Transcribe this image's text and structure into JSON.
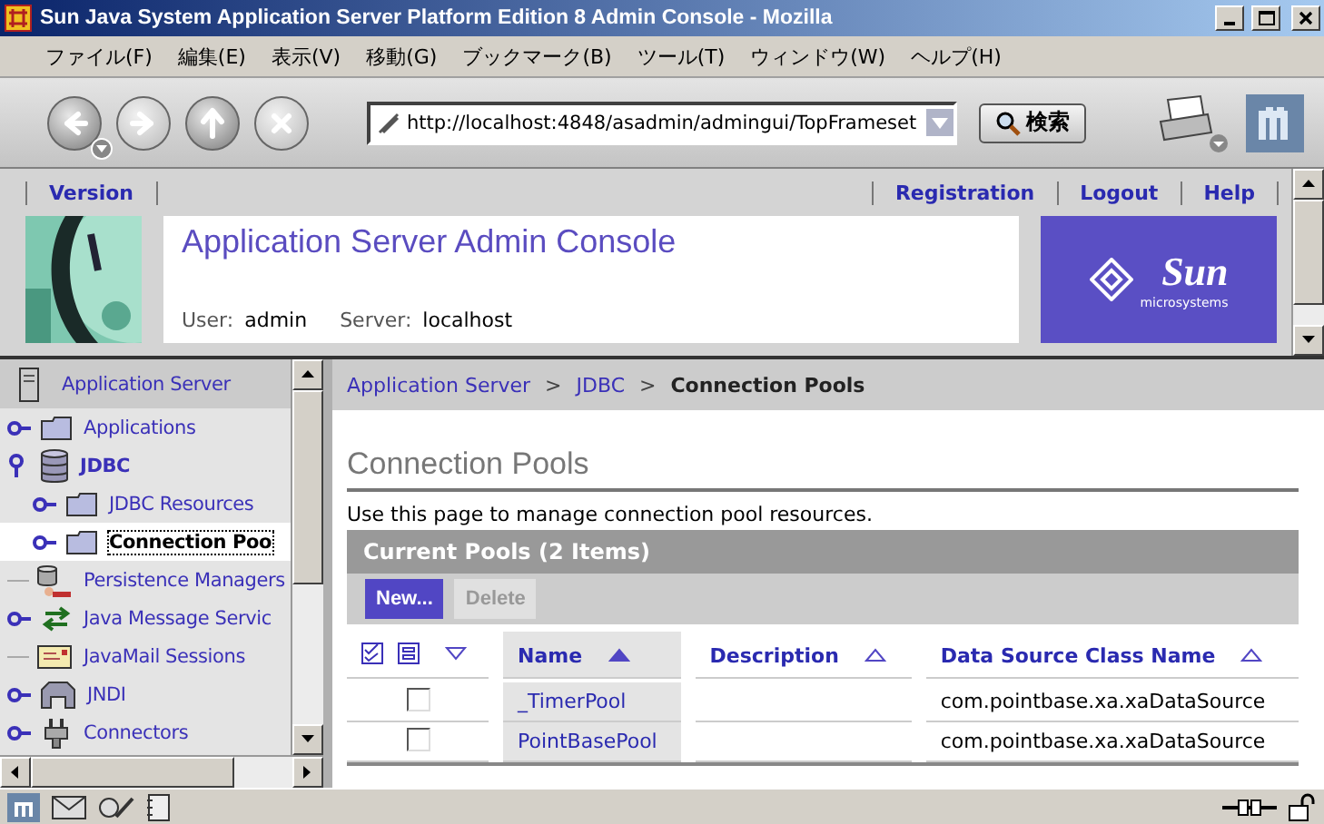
{
  "window": {
    "title": "Sun Java System Application Server Platform Edition 8 Admin Console - Mozilla"
  },
  "menu": [
    "ファイル(F)",
    "編集(E)",
    "表示(V)",
    "移動(G)",
    "ブックマーク(B)",
    "ツール(T)",
    "ウィンドウ(W)",
    "ヘルプ(H)"
  ],
  "toolbar": {
    "buttons": [
      {
        "kind": "back",
        "disabled": false,
        "dropdown": true
      },
      {
        "kind": "forward",
        "disabled": true,
        "dropdown": false
      },
      {
        "kind": "reload",
        "disabled": false,
        "dropdown": false
      },
      {
        "kind": "stop",
        "disabled": true,
        "dropdown": false
      }
    ],
    "url": "http://localhost:4848/asadmin/admingui/TopFrameset",
    "search": "検索"
  },
  "header": {
    "left_links": [
      "Version"
    ],
    "right_links": [
      "Registration",
      "Logout",
      "Help"
    ],
    "title": "Application Server Admin Console",
    "user_label": "User:",
    "user": "admin",
    "server_label": "Server:",
    "server": "localhost",
    "logo": {
      "name": "Sun",
      "tagline": "microsystems"
    }
  },
  "tree": {
    "root": {
      "label": "Application Server"
    },
    "items": [
      {
        "label": "Applications",
        "kind": "folder",
        "expandable": true,
        "expanded": false,
        "selected": false
      },
      {
        "label": "JDBC",
        "kind": "database",
        "expandable": true,
        "expanded": true,
        "selected": false,
        "children": [
          {
            "label": "JDBC Resources",
            "kind": "folder",
            "expandable": true,
            "expanded": false,
            "selected": false
          },
          {
            "label": "Connection Poo",
            "kind": "folder",
            "expandable": true,
            "expanded": false,
            "selected": true
          }
        ]
      },
      {
        "label": "Persistence Managers",
        "kind": "persistence",
        "expandable": false,
        "expanded": false,
        "selected": false
      },
      {
        "label": "Java Message Servic",
        "kind": "messaging",
        "expandable": true,
        "expanded": false,
        "selected": false
      },
      {
        "label": "JavaMail Sessions",
        "kind": "mail",
        "expandable": false,
        "expanded": false,
        "selected": false
      },
      {
        "label": "JNDI",
        "kind": "directory",
        "expandable": true,
        "expanded": false,
        "selected": false
      },
      {
        "label": "Connectors",
        "kind": "connector",
        "expandable": true,
        "expanded": false,
        "selected": false
      }
    ]
  },
  "breadcrumb": {
    "separator": ">",
    "items": [
      {
        "label": "Application Server",
        "current": false
      },
      {
        "label": "JDBC",
        "current": false
      },
      {
        "label": "Connection Pools",
        "current": true
      }
    ]
  },
  "page": {
    "title": "Connection Pools",
    "description": "Use this page to manage connection pool resources.",
    "table": {
      "title": "Current Pools (2 Items)",
      "buttons": [
        {
          "label": "New...",
          "disabled": false
        },
        {
          "label": "Delete",
          "disabled": true
        }
      ],
      "columns": [
        {
          "label": "Name",
          "sorted": true
        },
        {
          "label": "Description",
          "sorted": false
        },
        {
          "label": "Data Source Class Name",
          "sorted": false
        }
      ],
      "rows": [
        {
          "checked": false,
          "name": "_TimerPool",
          "class_name": "com.pointbase.xa.xaDataSource"
        },
        {
          "checked": false,
          "name": "PointBasePool",
          "class_name": "com.pointbase.xa.xaDataSource"
        }
      ]
    }
  }
}
